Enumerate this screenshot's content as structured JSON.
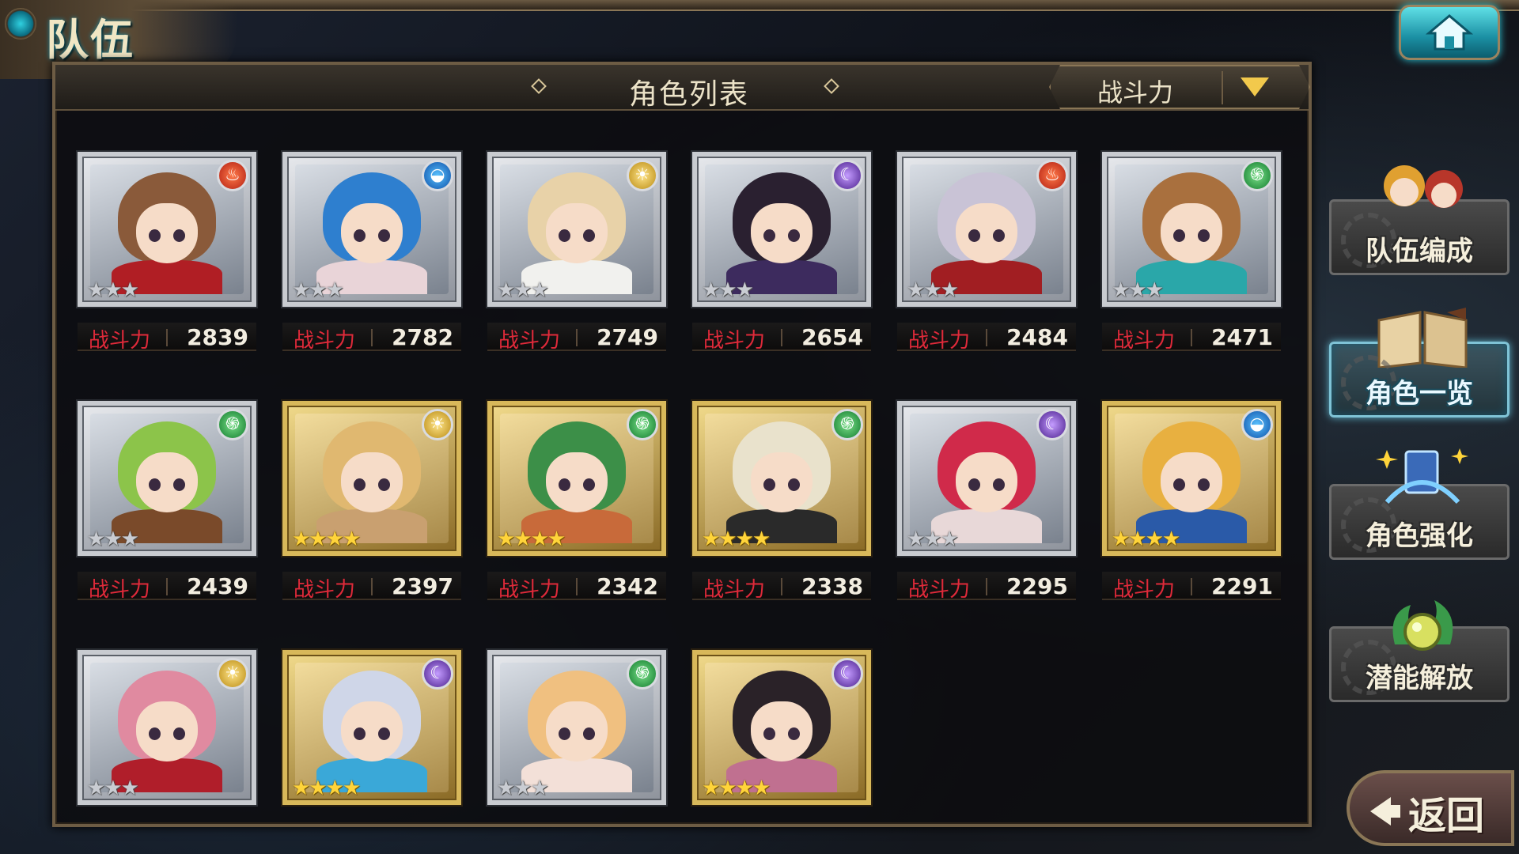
{
  "header": {
    "title": "队伍",
    "home_icon": "home-icon"
  },
  "panel": {
    "title": "角色列表",
    "sort": {
      "selected": "战斗力"
    }
  },
  "characters": [
    {
      "element": "fire",
      "rarity": 3,
      "power_label": "战斗力",
      "power": "2839",
      "hair": "#8a5a3a",
      "outfit": "#b01e24"
    },
    {
      "element": "water",
      "rarity": 3,
      "power_label": "战斗力",
      "power": "2782",
      "hair": "#2e7fcf",
      "outfit": "#e9d4d8"
    },
    {
      "element": "light",
      "rarity": 3,
      "power_label": "战斗力",
      "power": "2749",
      "hair": "#e8d2a8",
      "outfit": "#f1f1ee"
    },
    {
      "element": "dark",
      "rarity": 3,
      "power_label": "战斗力",
      "power": "2654",
      "hair": "#2a2030",
      "outfit": "#3d2b5e"
    },
    {
      "element": "fire",
      "rarity": 3,
      "power_label": "战斗力",
      "power": "2484",
      "hair": "#c9c3d6",
      "outfit": "#a11e22"
    },
    {
      "element": "wind",
      "rarity": 3,
      "power_label": "战斗力",
      "power": "2471",
      "hair": "#a9703e",
      "outfit": "#2aa7a9"
    },
    {
      "element": "wind",
      "rarity": 3,
      "power_label": "战斗力",
      "power": "2439",
      "hair": "#8cc44a",
      "outfit": "#7a4a2a"
    },
    {
      "element": "light",
      "rarity": 4,
      "power_label": "战斗力",
      "power": "2397",
      "hair": "#e0b870",
      "outfit": "#c9a070"
    },
    {
      "element": "wind",
      "rarity": 4,
      "power_label": "战斗力",
      "power": "2342",
      "hair": "#3c8f48",
      "outfit": "#c86a3a"
    },
    {
      "element": "wind",
      "rarity": 4,
      "power_label": "战斗力",
      "power": "2338",
      "hair": "#e9e2cc",
      "outfit": "#2a2a2a"
    },
    {
      "element": "dark",
      "rarity": 3,
      "power_label": "战斗力",
      "power": "2295",
      "hair": "#d02a4a",
      "outfit": "#e8d8d8"
    },
    {
      "element": "water",
      "rarity": 4,
      "power_label": "战斗力",
      "power": "2291",
      "hair": "#e8b040",
      "outfit": "#2a5aa8"
    },
    {
      "element": "light",
      "rarity": 3,
      "power_label": "",
      "power": "",
      "hair": "#e08aa0",
      "outfit": "#b01e2a"
    },
    {
      "element": "dark",
      "rarity": 4,
      "power_label": "",
      "power": "",
      "hair": "#cfd6e8",
      "outfit": "#3aa8d8"
    },
    {
      "element": "wind",
      "rarity": 3,
      "power_label": "",
      "power": "",
      "hair": "#f0c080",
      "outfit": "#f3e0d8"
    },
    {
      "element": "dark",
      "rarity": 4,
      "power_label": "",
      "power": "",
      "hair": "#2a2228",
      "outfit": "#c07090"
    }
  ],
  "side_menu": [
    {
      "label": "队伍编成",
      "icon": "team-members-icon",
      "active": false
    },
    {
      "label": "角色一览",
      "icon": "book-icon",
      "active": true
    },
    {
      "label": "角色强化",
      "icon": "enhance-card-icon",
      "active": false
    },
    {
      "label": "潜能解放",
      "icon": "potential-orb-icon",
      "active": false
    }
  ],
  "back_button": {
    "label": "返回"
  },
  "colors": {
    "power_label": "#e02a3a",
    "sort_arrow": "#f2c94c",
    "home_button": "#1b8fa3",
    "active_menu": "#7fc3d6"
  }
}
